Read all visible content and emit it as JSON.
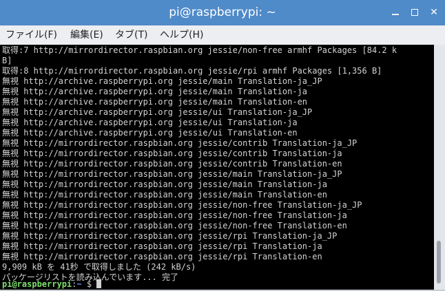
{
  "window": {
    "title": "pi@raspberrypi: ~",
    "minimize": "",
    "maximize": "",
    "close": "✕"
  },
  "menubar": {
    "items": [
      {
        "label": "ファイル(F)"
      },
      {
        "label": "編集(E)"
      },
      {
        "label": "タブ(T)"
      },
      {
        "label": "ヘルプ(H)"
      }
    ]
  },
  "terminal": {
    "lines": [
      "取得:7 http://mirrordirector.raspbian.org jessie/non-free armhf Packages [84.2 k",
      "B]",
      "取得:8 http://mirrordirector.raspbian.org jessie/rpi armhf Packages [1,356 B]",
      "無視 http://archive.raspberrypi.org jessie/main Translation-ja_JP",
      "無視 http://archive.raspberrypi.org jessie/main Translation-ja",
      "無視 http://archive.raspberrypi.org jessie/main Translation-en",
      "無視 http://archive.raspberrypi.org jessie/ui Translation-ja_JP",
      "無視 http://archive.raspberrypi.org jessie/ui Translation-ja",
      "無視 http://archive.raspberrypi.org jessie/ui Translation-en",
      "無視 http://mirrordirector.raspbian.org jessie/contrib Translation-ja_JP",
      "無視 http://mirrordirector.raspbian.org jessie/contrib Translation-ja",
      "無視 http://mirrordirector.raspbian.org jessie/contrib Translation-en",
      "無視 http://mirrordirector.raspbian.org jessie/main Translation-ja_JP",
      "無視 http://mirrordirector.raspbian.org jessie/main Translation-ja",
      "無視 http://mirrordirector.raspbian.org jessie/main Translation-en",
      "無視 http://mirrordirector.raspbian.org jessie/non-free Translation-ja_JP",
      "無視 http://mirrordirector.raspbian.org jessie/non-free Translation-ja",
      "無視 http://mirrordirector.raspbian.org jessie/non-free Translation-en",
      "無視 http://mirrordirector.raspbian.org jessie/rpi Translation-ja_JP",
      "無視 http://mirrordirector.raspbian.org jessie/rpi Translation-ja",
      "無視 http://mirrordirector.raspbian.org jessie/rpi Translation-en",
      "9,909 kB を 41秒 で取得しました (242 kB/s)",
      "パッケージリストを読み込んでいます... 完了"
    ],
    "prompt": {
      "user_host": "pi@raspberrypi",
      "colon": ":",
      "path": "~",
      "symbol": " $ "
    }
  },
  "colors": {
    "titlebar": "#4f8ac9",
    "terminal_bg": "#000000",
    "terminal_fg": "#d3d3d3",
    "prompt_user": "#7fe06f",
    "prompt_path": "#6b8cff"
  }
}
